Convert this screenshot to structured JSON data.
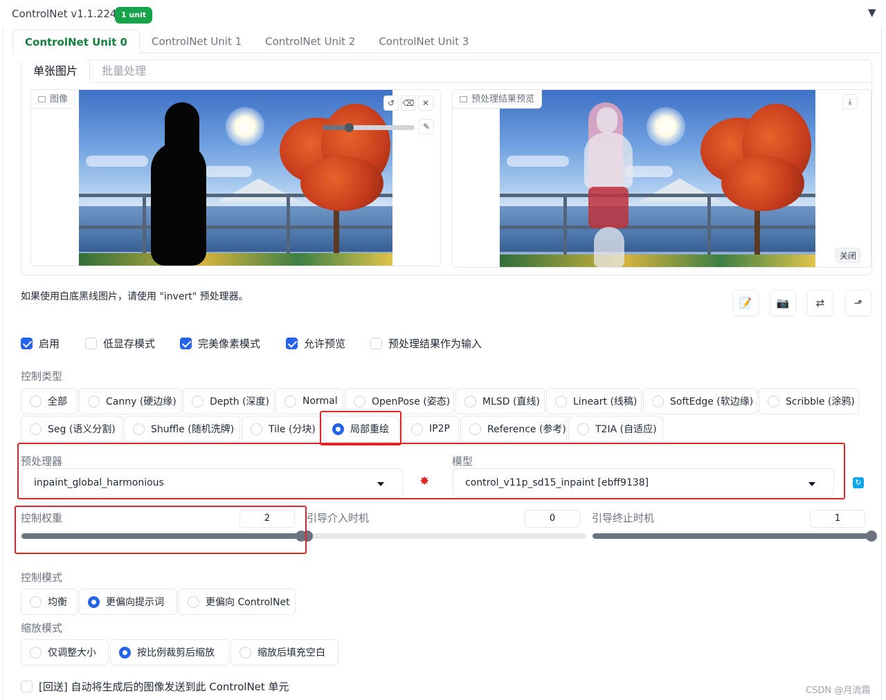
{
  "header": {
    "title": "ControlNet v1.1.224",
    "badge": "1 unit",
    "collapse_icon": "triangle-down-icon"
  },
  "unit_tabs": [
    {
      "label": "ControlNet Unit 0",
      "active": true
    },
    {
      "label": "ControlNet Unit 1",
      "active": false
    },
    {
      "label": "ControlNet Unit 2",
      "active": false
    },
    {
      "label": "ControlNet Unit 3",
      "active": false
    }
  ],
  "sub_tabs": [
    {
      "label": "单张图片",
      "active": true
    },
    {
      "label": "批量处理",
      "active": false
    }
  ],
  "image_panel": {
    "label": "图像",
    "icon": "image-icon"
  },
  "preview_panel": {
    "label": "预处理结果预览",
    "icon": "image-icon",
    "close_label": "关闭"
  },
  "hint": "如果使用白底黑线图片，请使用 \"invert\" 预处理器。",
  "checkboxes": [
    {
      "label": "启用",
      "checked": true
    },
    {
      "label": "低显存模式",
      "checked": false
    },
    {
      "label": "完美像素模式",
      "checked": true
    },
    {
      "label": "允许预览",
      "checked": true
    },
    {
      "label": "预处理结果作为输入",
      "checked": false
    }
  ],
  "control_type": {
    "label": "控制类型",
    "options": [
      "全部",
      "Canny (硬边缘)",
      "Depth (深度)",
      "Normal",
      "OpenPose (姿态)",
      "MLSD (直线)",
      "Lineart (线稿)",
      "SoftEdge (软边缘)",
      "Scribble (涂鸦)",
      "Seg (语义分割)",
      "Shuffle (随机洗牌)",
      "Tile (分块)",
      "局部重绘",
      "IP2P",
      "Reference (参考)",
      "T2IA (自适应)"
    ],
    "selected": "局部重绘"
  },
  "preprocessor": {
    "label": "预处理器",
    "value": "inpaint_global_harmonious"
  },
  "model": {
    "label": "模型",
    "value": "control_v11p_sd15_inpaint [ebff9138]"
  },
  "sliders": {
    "weight": {
      "label": "控制权重",
      "value": "2",
      "fraction": 1.0
    },
    "start": {
      "label": "引导介入时机",
      "value": "0",
      "fraction": 0.0
    },
    "end": {
      "label": "引导终止时机",
      "value": "1",
      "fraction": 1.0
    }
  },
  "control_mode": {
    "label": "控制模式",
    "options": [
      "均衡",
      "更偏向提示词",
      "更偏向 ControlNet"
    ],
    "selected": "更偏向提示词"
  },
  "resize_mode": {
    "label": "缩放模式",
    "options": [
      "仅调整大小",
      "按比例裁剪后缩放",
      "缩放后填充空白"
    ],
    "selected": "按比例裁剪后缩放"
  },
  "loopback": {
    "label": "[回送] 自动将生成后的图像发送到此 ControlNet 单元",
    "checked": false
  },
  "watermark": "CSDN @月流霜",
  "colors": {
    "accent": "#2563eb",
    "active_tab": "#15803d",
    "badge": "#16a34a",
    "highlight": "#e02424"
  }
}
